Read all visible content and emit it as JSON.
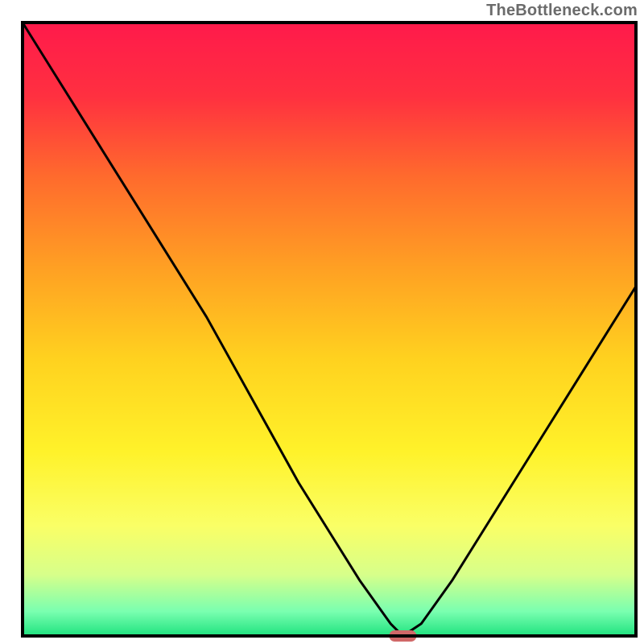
{
  "watermark": "TheBottleneck.com",
  "chart_data": {
    "type": "line",
    "title": "",
    "xlabel": "",
    "ylabel": "",
    "xlim": [
      0,
      100
    ],
    "ylim": [
      0,
      100
    ],
    "x": [
      0,
      5,
      10,
      15,
      20,
      25,
      30,
      35,
      40,
      45,
      50,
      55,
      60,
      62,
      65,
      70,
      75,
      80,
      85,
      90,
      95,
      100
    ],
    "values": [
      100,
      92,
      84,
      76,
      68,
      60,
      52,
      43,
      34,
      25,
      17,
      9,
      2,
      0,
      2,
      9,
      17,
      25,
      33,
      41,
      49,
      57
    ],
    "marker": {
      "x": 62,
      "y": 0
    },
    "gradient_stops": [
      {
        "offset": 0.0,
        "color": "#ff1a4b"
      },
      {
        "offset": 0.12,
        "color": "#ff3040"
      },
      {
        "offset": 0.25,
        "color": "#ff6a2d"
      },
      {
        "offset": 0.4,
        "color": "#ffa023"
      },
      {
        "offset": 0.55,
        "color": "#ffd21f"
      },
      {
        "offset": 0.7,
        "color": "#fff22a"
      },
      {
        "offset": 0.82,
        "color": "#faff66"
      },
      {
        "offset": 0.9,
        "color": "#d7ff8a"
      },
      {
        "offset": 0.96,
        "color": "#7affb0"
      },
      {
        "offset": 1.0,
        "color": "#1fe27f"
      }
    ],
    "frame_color": "#000000",
    "line_color": "#000000",
    "marker_color": "#d06868"
  }
}
